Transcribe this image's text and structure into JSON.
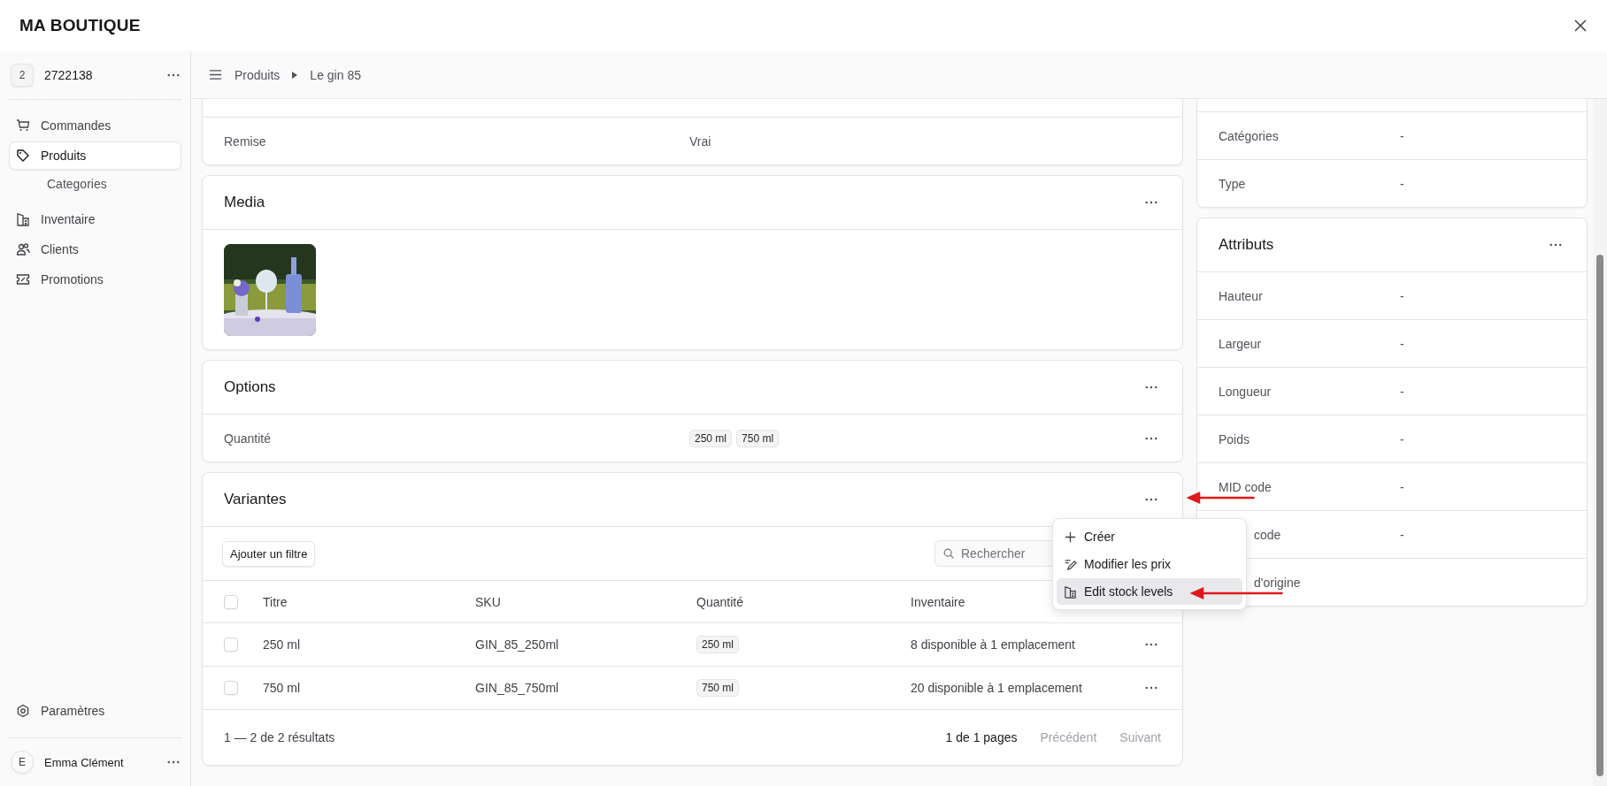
{
  "header": {
    "title": "MA BOUTIQUE"
  },
  "sidebar": {
    "store": {
      "badge": "2",
      "name": "2722138"
    },
    "items": [
      {
        "label": "Commandes",
        "selected": false
      },
      {
        "label": "Produits",
        "selected": true,
        "children": [
          {
            "label": "Categories",
            "selected": false
          }
        ]
      },
      {
        "label": "Inventaire",
        "selected": false
      },
      {
        "label": "Clients",
        "selected": false
      },
      {
        "label": "Promotions",
        "selected": false
      }
    ],
    "footer_items": [
      {
        "label": "Paramètres"
      }
    ],
    "user": {
      "initial": "E",
      "name": "Emma Clément"
    }
  },
  "breadcrumb": [
    "Produits",
    "Le gin 85"
  ],
  "general_card": {
    "rows": [
      {
        "label": "Remise",
        "value": "Vrai"
      }
    ]
  },
  "media_card": {
    "title": "Media"
  },
  "options_card": {
    "title": "Options",
    "rows": [
      {
        "label": "Quantité",
        "values": [
          "250 ml",
          "750 ml"
        ]
      }
    ]
  },
  "variants_card": {
    "title": "Variantes",
    "filter_button": "Ajouter un filtre",
    "search": {
      "placeholder": "Rechercher"
    },
    "all_checked": false,
    "columns": [
      "Titre",
      "SKU",
      "Quantité",
      "Inventaire"
    ],
    "rows": [
      {
        "checked": false,
        "title": "250 ml",
        "sku": "GIN_85_250ml",
        "quantity": "250 ml",
        "inventory": "8 disponible à 1 emplacement"
      },
      {
        "checked": false,
        "title": "750 ml",
        "sku": "GIN_85_750ml",
        "quantity": "750 ml",
        "inventory": "20 disponible à 1 emplacement"
      }
    ],
    "footer": {
      "count": "1 — 2 de 2 résultats",
      "pages": "1 de 1 pages",
      "previous": {
        "label": "Précédent",
        "disabled": true
      },
      "next": {
        "label": "Suivant",
        "disabled": true
      }
    },
    "menu": {
      "items": [
        {
          "label": "Créer",
          "selected": false
        },
        {
          "label": "Modifier les prix",
          "selected": false
        },
        {
          "label": "Edit stock levels",
          "selected": true
        }
      ]
    }
  },
  "organize_card": {
    "rows": [
      {
        "label": "Catégories",
        "value": "-"
      },
      {
        "label": "Type",
        "value": "-"
      }
    ]
  },
  "attributes_card": {
    "title": "Attributs",
    "rows": [
      {
        "kind": "plain",
        "label": "Hauteur",
        "value": "-"
      },
      {
        "kind": "plain",
        "label": "Largeur",
        "value": "-"
      },
      {
        "kind": "plain",
        "label": "Longueur",
        "value": "-"
      },
      {
        "kind": "plain",
        "label": "Poids",
        "value": "-"
      },
      {
        "kind": "plain",
        "label": "MID code",
        "value": "-"
      },
      {
        "kind": "overlapped",
        "label": "code",
        "value": "-"
      },
      {
        "kind": "overlapped",
        "label": "d'origine"
      }
    ]
  }
}
